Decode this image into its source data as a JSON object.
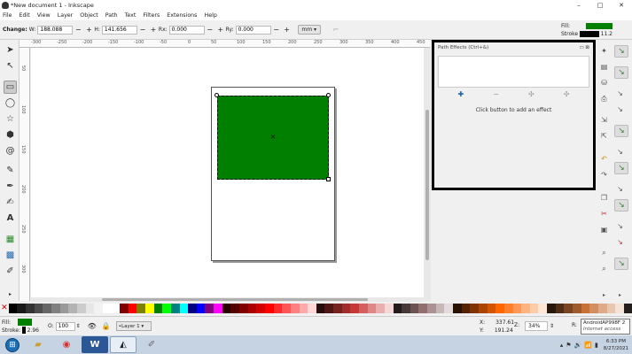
{
  "window": {
    "title": "*New document 1 - Inkscape",
    "min": "–",
    "max": "□",
    "close": "✕"
  },
  "menu": [
    "File",
    "Edit",
    "View",
    "Layer",
    "Object",
    "Path",
    "Text",
    "Filters",
    "Extensions",
    "Help"
  ],
  "controls": {
    "change_label": "Change:",
    "w_label": "W:",
    "w_value": "188.088",
    "h_label": "H:",
    "h_value": "141.656",
    "rx_label": "Rx:",
    "rx_value": "0.000",
    "ry_label": "Ry:",
    "ry_value": "0.000",
    "unit": "mm ▾",
    "plus": "+",
    "minus": "−"
  },
  "style_indicator": {
    "fill_label": "Fill:",
    "stroke_label": "Stroke",
    "stroke_width": "11.2",
    "fill_color": "#007f00",
    "stroke_color": "#000000"
  },
  "ruler": {
    "h_ticks": [
      "-300",
      "-250",
      "-200",
      "-150",
      "-100",
      "-50",
      "0",
      "50",
      "100",
      "150",
      "200",
      "250",
      "300",
      "350",
      "400",
      "450"
    ],
    "v_ticks": [
      "50",
      "100",
      "150",
      "200",
      "250",
      "300"
    ]
  },
  "panel": {
    "title": "Path Effects (Ctrl+&)",
    "add": "✚",
    "remove": "−",
    "up": "✣",
    "down": "✣",
    "hint": "Click button to add an effect"
  },
  "palette": [
    "#000000",
    "#1a1a1a",
    "#333333",
    "#4d4d4d",
    "#666666",
    "#808080",
    "#999999",
    "#b3b3b3",
    "#cccccc",
    "#e6e6e6",
    "#f2f2f2",
    "#ffffff",
    "#ffffff",
    "#800000",
    "#ff0000",
    "#808000",
    "#ffff00",
    "#008000",
    "#00ff00",
    "#008080",
    "#00ffff",
    "#000080",
    "#0000ff",
    "#800080",
    "#ff00ff",
    "#2b0000",
    "#550000",
    "#800000",
    "#aa0000",
    "#d40000",
    "#ff0000",
    "#ff2a2a",
    "#ff5555",
    "#ff8080",
    "#ffaaaa",
    "#ffd5d5",
    "#280b0b",
    "#501616",
    "#782121",
    "#a02c2c",
    "#c83737",
    "#d35f5f",
    "#de8787",
    "#e9afaf",
    "#f4d7d7",
    "#241c1c",
    "#483737",
    "#6c5353",
    "#916f6f",
    "#ac9393",
    "#c8b7b7",
    "#e3dbdb",
    "#2b1100",
    "#552200",
    "#803300",
    "#aa4400",
    "#d45500",
    "#ff6600",
    "#ff7f2a",
    "#ff9955",
    "#ffb380",
    "#ffccaa",
    "#ffe6d5",
    "#28170b",
    "#502d16",
    "#784421",
    "#a05a2c",
    "#c87137",
    "#d38d5f",
    "#deaa87",
    "#e9c6af",
    "#f4e3d7",
    "#241f1c"
  ],
  "status": {
    "fill_label": "Fill:",
    "stroke_label": "Stroke:",
    "stroke_width": "2.96",
    "o_label": "O:",
    "opacity": "100",
    "layer": "•Layer 1 ▾",
    "x_label": "X:",
    "x": "337.61",
    "y_label": "Y:",
    "y": "191.24",
    "z_label": "Z:",
    "zoom": "34%",
    "r_label": "R:",
    "tooltip_title": "AndroidAP998F 2",
    "tooltip_sub": "Internet access"
  },
  "taskbar": {
    "time": "6:33 PM",
    "date": "8/27/2021"
  }
}
